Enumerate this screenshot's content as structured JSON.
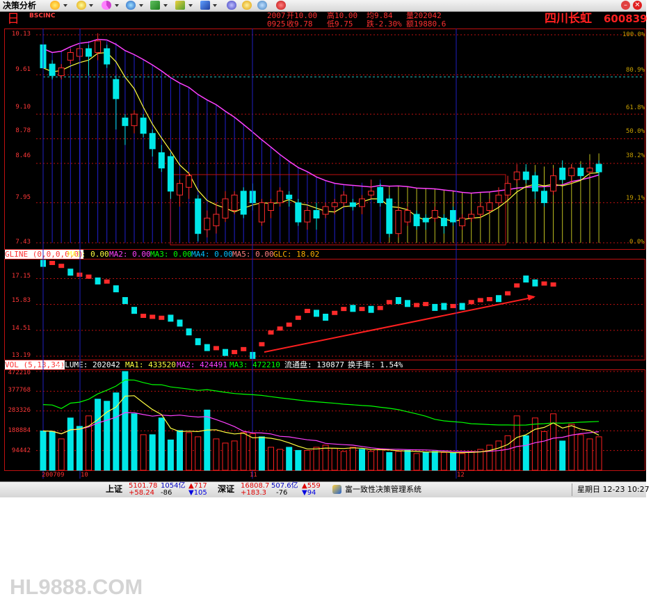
{
  "toolbar": {
    "title": "决策分析",
    "icons": [
      "sun-icon",
      "star-icon",
      "pie-icon",
      "globe-icon",
      "chart-icon",
      "pen-icon",
      "tool-icon",
      "gear-icon",
      "refresh-icon",
      "alarm-icon",
      "help-icon"
    ]
  },
  "header": {
    "period": "日",
    "code_label": "BSCINC",
    "q_date": "2007",
    "q_open": "开10.00",
    "q_high": "高10.00",
    "q_avg": "均9.84",
    "q_vol": "量202042",
    "q_time": "0925",
    "q_close": "收9.78",
    "q_low": "低9.75",
    "q_chg": "跌-2.30%",
    "q_amt": "额19880.6",
    "stock_name": "四川长虹",
    "stock_code": "600839"
  },
  "colors": {
    "up": "#ff2a2a",
    "down": "#00e8e8",
    "ma1": "#ffff40",
    "ma2": "#ff40ff",
    "ma3": "#00ff00",
    "grid": "#c01010",
    "fib": "#c8a000"
  },
  "price_panel": {
    "y_labels": [
      "10.13",
      "9.61",
      "9.10",
      "8.78",
      "8.46",
      "7.95",
      "7.43"
    ],
    "pct_labels": [
      "100.0%",
      "80.9%",
      "61.8%",
      "50.0%",
      "38.2%",
      "19.1%",
      "0.0%"
    ]
  },
  "gline_panel": {
    "legend": {
      "name": "GLINE (0,0,0,0,0)",
      "ma1": "MA1: 0.00",
      "ma2": "MA2: 0.00",
      "ma3": "MA3: 0.00",
      "ma4": "MA4: 0.00",
      "ma5": "MA5: 0.00",
      "glc": "GLC: 18.02"
    },
    "y_labels": [
      "17.15",
      "15.83",
      "14.51",
      "13.19"
    ]
  },
  "volume_panel": {
    "legend": {
      "name": "VOL (5,13,34)",
      "volume": "VOLUME: 202042",
      "ma1": "MA1: 433520",
      "ma2": "MA2: 424491",
      "ma3": "MA3: 472210",
      "float": "流通盘: 130877",
      "turnover": "换手率: 1.54%"
    },
    "y_labels": [
      "472210",
      "377768",
      "283326",
      "188884",
      "94442"
    ],
    "x_labels": [
      "200709",
      "10",
      "11",
      "12"
    ]
  },
  "chart_data": [
    {
      "type": "candlestick",
      "title": "",
      "ylim": [
        7.43,
        10.13
      ],
      "candles": [
        [
          10.0,
          9.7,
          10.0,
          9.6
        ],
        [
          9.75,
          9.6,
          9.8,
          9.55
        ],
        [
          9.6,
          9.7,
          9.75,
          9.55
        ],
        [
          9.8,
          9.9,
          9.95,
          9.75
        ],
        [
          9.85,
          9.95,
          10.0,
          9.8
        ],
        [
          9.95,
          9.85,
          10.0,
          9.6
        ],
        [
          9.9,
          10.05,
          10.15,
          9.8
        ],
        [
          9.95,
          9.75,
          10.0,
          9.7
        ],
        [
          9.55,
          9.3,
          9.6,
          8.9
        ],
        [
          9.05,
          8.95,
          9.1,
          8.7
        ],
        [
          8.95,
          9.1,
          9.15,
          8.85
        ],
        [
          9.05,
          8.85,
          9.1,
          8.8
        ],
        [
          8.85,
          8.65,
          8.9,
          8.55
        ],
        [
          8.6,
          8.4,
          8.7,
          8.35
        ],
        [
          8.55,
          8.1,
          8.6,
          8.0
        ],
        [
          8.05,
          8.2,
          8.25,
          7.9
        ],
        [
          8.15,
          8.3,
          8.35,
          8.0
        ],
        [
          8.0,
          7.55,
          8.05,
          7.45
        ],
        [
          7.6,
          7.75,
          7.85,
          7.5
        ],
        [
          7.65,
          7.8,
          7.95,
          7.55
        ],
        [
          7.75,
          8.0,
          8.1,
          7.7
        ],
        [
          7.85,
          8.05,
          8.1,
          7.8
        ],
        [
          8.1,
          7.8,
          8.15,
          7.75
        ],
        [
          8.1,
          7.95,
          8.2,
          7.85
        ],
        [
          7.7,
          7.95,
          8.0,
          7.65
        ],
        [
          7.85,
          7.95,
          8.0,
          7.75
        ],
        [
          7.95,
          8.1,
          8.15,
          7.9
        ],
        [
          8.05,
          8.0,
          8.1,
          7.9
        ],
        [
          7.95,
          7.7,
          8.0,
          7.65
        ],
        [
          7.7,
          7.85,
          7.9,
          7.6
        ],
        [
          7.85,
          7.75,
          7.95,
          7.6
        ],
        [
          7.8,
          7.9,
          7.95,
          7.75
        ],
        [
          7.9,
          7.95,
          8.0,
          7.8
        ],
        [
          7.95,
          8.05,
          8.1,
          7.9
        ],
        [
          7.95,
          7.9,
          8.0,
          7.85
        ],
        [
          7.9,
          8.0,
          8.05,
          7.8
        ],
        [
          8.05,
          8.1,
          8.25,
          8.0
        ],
        [
          8.15,
          7.95,
          8.2,
          7.9
        ],
        [
          8.0,
          7.55,
          8.05,
          7.5
        ],
        [
          7.55,
          7.85,
          7.9,
          7.5
        ],
        [
          7.7,
          7.85,
          7.9,
          7.65
        ],
        [
          7.8,
          7.65,
          7.85,
          7.6
        ],
        [
          7.75,
          7.7,
          7.8,
          7.6
        ],
        [
          7.75,
          7.85,
          7.9,
          7.7
        ],
        [
          7.75,
          7.65,
          7.8,
          7.55
        ],
        [
          7.85,
          7.7,
          7.9,
          7.65
        ],
        [
          7.65,
          7.75,
          7.8,
          7.6
        ],
        [
          7.75,
          7.8,
          7.85,
          7.7
        ],
        [
          7.8,
          7.9,
          7.95,
          7.75
        ],
        [
          7.85,
          7.95,
          8.0,
          7.8
        ],
        [
          7.95,
          8.05,
          8.15,
          7.9
        ],
        [
          8.05,
          8.2,
          8.3,
          8.0
        ],
        [
          8.25,
          8.35,
          8.45,
          8.2
        ],
        [
          8.35,
          8.25,
          8.45,
          8.2
        ],
        [
          8.3,
          8.1,
          8.35,
          8.0
        ],
        [
          8.1,
          7.95,
          8.15,
          7.9
        ],
        [
          8.1,
          8.3,
          8.4,
          8.05
        ],
        [
          8.4,
          8.25,
          8.5,
          8.2
        ],
        [
          8.3,
          8.4,
          8.45,
          8.2
        ],
        [
          8.4,
          8.3,
          8.45,
          8.25
        ],
        [
          8.35,
          8.4,
          8.5,
          8.3
        ],
        [
          8.45,
          8.35,
          8.5,
          8.3
        ]
      ]
    },
    {
      "type": "line",
      "title": "",
      "ylim": [
        13.19,
        18.02
      ],
      "blocks": [
        [
          18.0,
          1
        ],
        [
          17.95,
          0
        ],
        [
          17.8,
          0
        ],
        [
          17.55,
          1
        ],
        [
          17.35,
          0
        ],
        [
          17.25,
          0
        ],
        [
          17.1,
          1
        ],
        [
          17.0,
          0
        ],
        [
          16.7,
          1
        ],
        [
          16.1,
          1
        ],
        [
          15.6,
          1
        ],
        [
          15.25,
          0
        ],
        [
          15.2,
          0
        ],
        [
          15.15,
          0
        ],
        [
          15.2,
          1
        ],
        [
          14.95,
          1
        ],
        [
          14.5,
          1
        ],
        [
          14.0,
          1
        ],
        [
          13.7,
          1
        ],
        [
          13.6,
          0
        ],
        [
          13.45,
          1
        ],
        [
          13.4,
          0
        ],
        [
          13.55,
          0
        ],
        [
          13.3,
          1
        ],
        [
          13.8,
          0
        ],
        [
          14.4,
          0
        ],
        [
          14.6,
          0
        ],
        [
          14.8,
          0
        ],
        [
          15.15,
          0
        ],
        [
          15.5,
          0
        ],
        [
          15.45,
          1
        ],
        [
          15.25,
          1
        ],
        [
          15.4,
          0
        ],
        [
          15.6,
          0
        ],
        [
          15.7,
          1
        ],
        [
          15.6,
          0
        ],
        [
          15.65,
          1
        ],
        [
          15.65,
          0
        ],
        [
          15.95,
          0
        ],
        [
          16.1,
          1
        ],
        [
          15.95,
          1
        ],
        [
          15.8,
          0
        ],
        [
          15.85,
          0
        ],
        [
          15.75,
          1
        ],
        [
          15.8,
          1
        ],
        [
          15.75,
          0
        ],
        [
          15.8,
          1
        ],
        [
          15.95,
          0
        ],
        [
          16.05,
          0
        ],
        [
          16.1,
          0
        ],
        [
          16.2,
          1
        ],
        [
          16.4,
          0
        ],
        [
          16.8,
          0
        ],
        [
          17.2,
          1
        ],
        [
          17.0,
          1
        ],
        [
          16.9,
          0
        ],
        [
          16.85,
          0
        ]
      ],
      "trend": [
        [
          13.4,
          16.2
        ]
      ]
    },
    {
      "type": "bar",
      "title": "",
      "ylim": [
        0,
        472210
      ],
      "volumes": [
        [
          188000,
          1
        ],
        [
          185000,
          1
        ],
        [
          150000,
          0
        ],
        [
          250000,
          1
        ],
        [
          210000,
          1
        ],
        [
          260000,
          0
        ],
        [
          340000,
          1
        ],
        [
          330000,
          1
        ],
        [
          370000,
          1
        ],
        [
          472210,
          1
        ],
        [
          270000,
          1
        ],
        [
          170000,
          0
        ],
        [
          170000,
          1
        ],
        [
          250000,
          1
        ],
        [
          145000,
          1
        ],
        [
          190000,
          1
        ],
        [
          180000,
          0
        ],
        [
          160000,
          0
        ],
        [
          288000,
          1
        ],
        [
          150000,
          0
        ],
        [
          130000,
          0
        ],
        [
          140000,
          0
        ],
        [
          180000,
          0
        ],
        [
          175000,
          0
        ],
        [
          160000,
          1
        ],
        [
          110000,
          0
        ],
        [
          100000,
          0
        ],
        [
          110000,
          1
        ],
        [
          95000,
          1
        ],
        [
          95000,
          0
        ],
        [
          110000,
          0
        ],
        [
          120000,
          0
        ],
        [
          105000,
          0
        ],
        [
          90000,
          0
        ],
        [
          110000,
          0
        ],
        [
          100000,
          1
        ],
        [
          90000,
          0
        ],
        [
          100000,
          0
        ],
        [
          85000,
          1
        ],
        [
          90000,
          0
        ],
        [
          95000,
          1
        ],
        [
          80000,
          0
        ],
        [
          85000,
          1
        ],
        [
          90000,
          1
        ],
        [
          85000,
          0
        ],
        [
          82000,
          1
        ],
        [
          80000,
          0
        ],
        [
          90000,
          0
        ],
        [
          100000,
          0
        ],
        [
          120000,
          0
        ],
        [
          140000,
          0
        ],
        [
          165000,
          0
        ],
        [
          260000,
          0
        ],
        [
          165000,
          1
        ],
        [
          250000,
          0
        ],
        [
          185000,
          0
        ],
        [
          270000,
          0
        ],
        [
          140000,
          1
        ],
        [
          220000,
          0
        ],
        [
          170000,
          0
        ],
        [
          150000,
          0
        ],
        [
          160000,
          0
        ]
      ]
    }
  ],
  "statusbar": {
    "sh_label": "上证",
    "sh_index": "5101.78",
    "sh_change": "+58.24",
    "sh_amount": "1054亿",
    "sh_diff": "-86",
    "sh_up": "▲717",
    "sh_down": "▼105",
    "sz_label": "深证",
    "sz_index": "16808.7",
    "sz_change": "+183.3",
    "sz_amount": "507.6亿",
    "sz_diff": "-76",
    "sz_up": "▲559",
    "sz_down": "▼94",
    "app_name": "富一致性决策管理系统",
    "datetime": "星期日 12-23 10:27"
  },
  "watermark": "HL9888.COM"
}
